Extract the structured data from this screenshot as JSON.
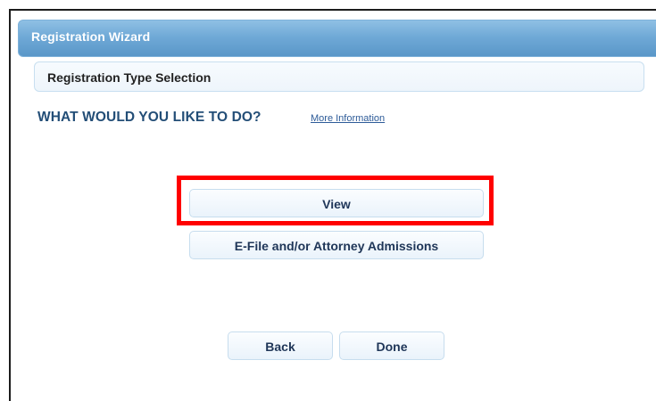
{
  "wizard": {
    "title": "Registration Wizard"
  },
  "section": {
    "title": "Registration Type Selection"
  },
  "prompt": {
    "question": "WHAT WOULD YOU LIKE TO DO?",
    "more_info_label": "More Information"
  },
  "options": {
    "view_label": "View",
    "efile_label": "E-File and/or Attorney Admissions"
  },
  "footer": {
    "back_label": "Back",
    "done_label": "Done"
  },
  "colors": {
    "header_gradient_top": "#8fc0e4",
    "header_gradient_bottom": "#5a97c8",
    "question_text": "#234e77",
    "highlight_border": "#ff0000",
    "link": "#2d5b98"
  }
}
